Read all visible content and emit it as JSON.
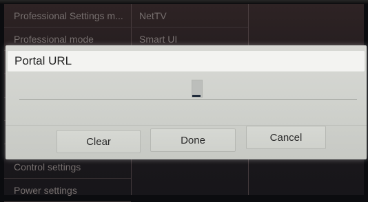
{
  "menu": {
    "column1": [
      "Professional Settings m...",
      "Professional mode",
      "",
      "",
      "",
      "",
      "Control settings",
      "Power settings"
    ],
    "column2": [
      "NetTV",
      "Smart UI"
    ]
  },
  "dialog": {
    "title": "Portal URL",
    "url_value": "",
    "buttons": {
      "clear": "Clear",
      "done": "Done",
      "cancel": "Cancel"
    }
  }
}
